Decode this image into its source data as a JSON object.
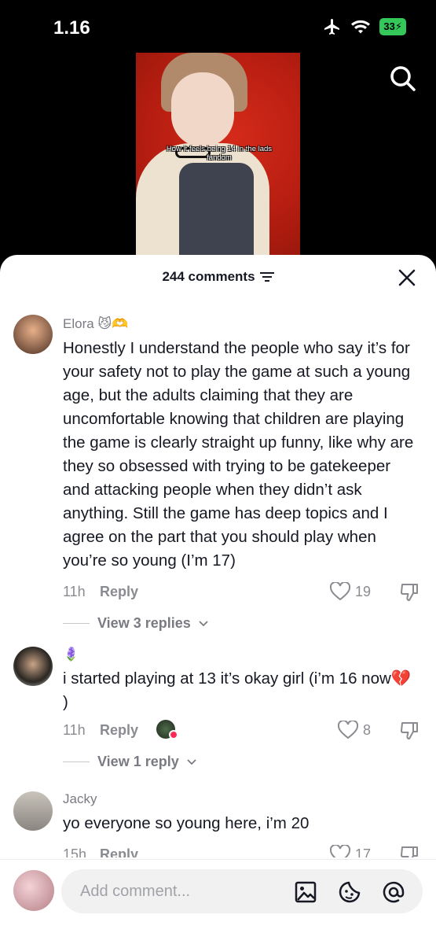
{
  "status_bar": {
    "time": "1.16",
    "battery": "33"
  },
  "video": {
    "caption": "How it feels being 14 in the lads fandom"
  },
  "sheet": {
    "comment_count": "244 comments"
  },
  "comments": [
    {
      "username": "Elora",
      "username_emoji": "😼🫶",
      "text": "Honestly I understand the people who say it’s for your safety not to play the game at such a young age, but the adults claiming that they are uncomfortable knowing that children are playing the game is clearly straight up funny, like why are they so obsessed with trying to be gatekeeper and attacking people when they didn’t ask anything. Still the game has deep topics and I agree on the part that you should play when you’re so young (I’m 17)",
      "time": "11h",
      "reply_label": "Reply",
      "likes": "19",
      "view_replies": "View 3 replies"
    },
    {
      "username": "🪻",
      "text": "i started playing at 13 it’s okay girl (i’m 16 now💔 )",
      "time": "11h",
      "reply_label": "Reply",
      "likes": "8",
      "view_replies": "View 1 reply"
    },
    {
      "username": "Jacky",
      "text": "yo everyone so young here, i’m 20",
      "time": "15h",
      "reply_label": "Reply",
      "likes": "17"
    }
  ],
  "composer": {
    "placeholder": "Add comment..."
  },
  "colors": {
    "accent_red": "#fe2c55",
    "text_primary": "#161823",
    "text_secondary": "#8a8b91"
  },
  "icons": [
    "airplane-icon",
    "wifi-icon",
    "battery-icon",
    "search-icon",
    "filter-icon",
    "close-icon",
    "heart-icon",
    "dislike-icon",
    "chevron-down-icon",
    "image-icon",
    "sticker-icon",
    "mention-icon"
  ]
}
